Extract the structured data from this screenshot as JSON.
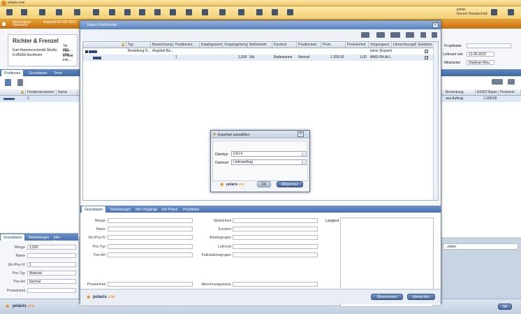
{
  "app": {
    "title": "polaris one"
  },
  "user": {
    "name": "admin",
    "company": "Dennis Haustechnik"
  },
  "nav": {
    "item1_line1": "Persönliche",
    "item1_line2": "Übersicht",
    "item2": "Angebot-00-AB-2012"
  },
  "address": {
    "company": "Richter & Frenzel",
    "street": "Karl-Hammerschmidt-Straße",
    "city": "D-85609 Aschheim",
    "tel": "Tel: 089-...",
    "fax": "Fax: 089-...",
    "email": "E-Mail: info..."
  },
  "right_info": {
    "projekt_label": "Projektakte",
    "lieferant_label": "Lieferant seit",
    "lieferant_value": "12.05.2010",
    "mitarbeiter_label": "Mitarbeiter",
    "mitarbeiter_value": "Stephan Weu"
  },
  "main_tabs": [
    "Positionen",
    "Grunddaten",
    "Texte"
  ],
  "main_grid": {
    "headers": [
      "Positionsnummer",
      "Name"
    ],
    "row": {
      "num": "1"
    },
    "right_headers": [
      "Bemerkung",
      "EK/EP-Basis",
      "Preiseinh"
    ],
    "right_row": {
      "bemerkung": "aus Auftrag",
      "ek": "1.200,00"
    }
  },
  "lower_tabs": [
    "Grunddaten",
    "Teilleistungen",
    "Info-Vorgänge"
  ],
  "lower_form": {
    "menge_label": "Menge",
    "menge_value": "1,000",
    "name_label": "Name",
    "ebpos_label": "Eb-/Pos-IV",
    "ebpos_value": "1",
    "postyp_label": "Pos-Typ",
    "postyp_value": "Material",
    "posart_label": "Pos-Art",
    "posart_value": "Normal",
    "preiseinheit_label": "Preiseinheit"
  },
  "bottom": {
    "ok": "OK",
    "right_field": "...ishen"
  },
  "export_dialog": {
    "title": "Export Großhandel",
    "headers": [
      "Typ",
      "Bezeichnung",
      "Positionsnr.",
      "Katalognumm.",
      "Vorgangsmenge",
      "Maßeinheit",
      "Kurztext",
      "Positionsart",
      "Preis",
      "Preiseinheit",
      "Vorgangsart.",
      "Umrechnungsfaktor",
      "Selektion"
    ],
    "row1": {
      "typ": "Bestellung D-...",
      "bez": "Angebot Ba...",
      "vorgangsart": "keine (Export)"
    },
    "row2": {
      "pos": "1",
      "menge": "1,000",
      "einheit": "Stk",
      "kurztext": "Badewanne",
      "art": "Normal",
      "preis": "1.200,00",
      "peinh": "1,00",
      "vorg": "AMG-PA-AU..."
    },
    "tabs": [
      "Grunddaten",
      "Teilleistungen",
      "Info-Vorgänge",
      "EK-Preise",
      "Preisfelder"
    ],
    "form": {
      "menge": "Menge",
      "name": "Name",
      "ebpos": "Eb-/Pos-IV",
      "postyp": "Pos-Typ",
      "posart": "Pos-Art",
      "preiseinheit": "Preiseinheit",
      "masseinheit": "Maßeinheit",
      "kurztext": "Kurztext",
      "arbeitsgruppe": "Arbeitsgruppe",
      "lohnzeit": "Lohnzeit",
      "kalkulationsgruppe": "Kalkulationsgruppe",
      "abrechnungsstatus": "Abrechnungsstatus",
      "langtext": "Langtext"
    },
    "buttons": {
      "uebernehmen": "Übernehmen",
      "abbrechen": "Abbrechen"
    }
  },
  "exportart_dialog": {
    "title": "Exportart auswählen",
    "dateityp_label": "Dateityp",
    "dateityp_value": "UGL4",
    "datenart_label": "Datenart",
    "datenart_value": "Lieferauftrag",
    "ok": "OK",
    "abbrechen": "Abbrechen"
  },
  "logo": {
    "main": "polaris",
    "accent": "one"
  },
  "colors": {
    "accent_orange": "#e38b1a",
    "header_blue": "#4d74b2",
    "brand_navy": "#1f2d55"
  }
}
